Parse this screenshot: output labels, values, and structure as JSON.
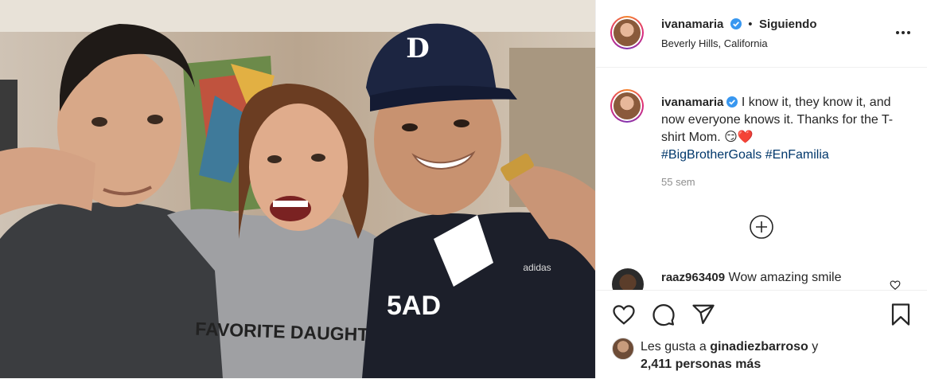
{
  "post": {
    "header": {
      "username": "ivanamaria",
      "follow_status": "Siguiendo",
      "separator": "•",
      "location": "Beverly Hills, California"
    },
    "caption": {
      "username": "ivanamaria",
      "text": "I know it, they know it, and now everyone knows it. Thanks for the T-shirt Mom.",
      "emojis": "😏❤️",
      "hashtag_1": "#BigBrotherGoals",
      "hashtag_2": "#EnFamilia",
      "time": "55 sem"
    },
    "comment": {
      "username": "raaz963409",
      "text": "Wow amazing smile"
    },
    "likes": {
      "prefix": "Les gusta a",
      "user": "ginadiezbarroso",
      "joiner": "y",
      "others": "2,411 personas más"
    },
    "photo": {
      "shirt_text_left": "FAVORITE DAUGHTER",
      "shirt_text_right": "5AD",
      "cap_letter": "D",
      "jacket_brand": "adidas"
    }
  },
  "icons": [
    "more-options-icon",
    "verified-icon",
    "load-comments-icon",
    "heart-icon",
    "comment-icon",
    "share-icon",
    "bookmark-icon"
  ],
  "colors": {
    "verified": "#3897f0",
    "hashtag": "#00376b",
    "time": "#8e8e8e",
    "border": "#efefef"
  }
}
